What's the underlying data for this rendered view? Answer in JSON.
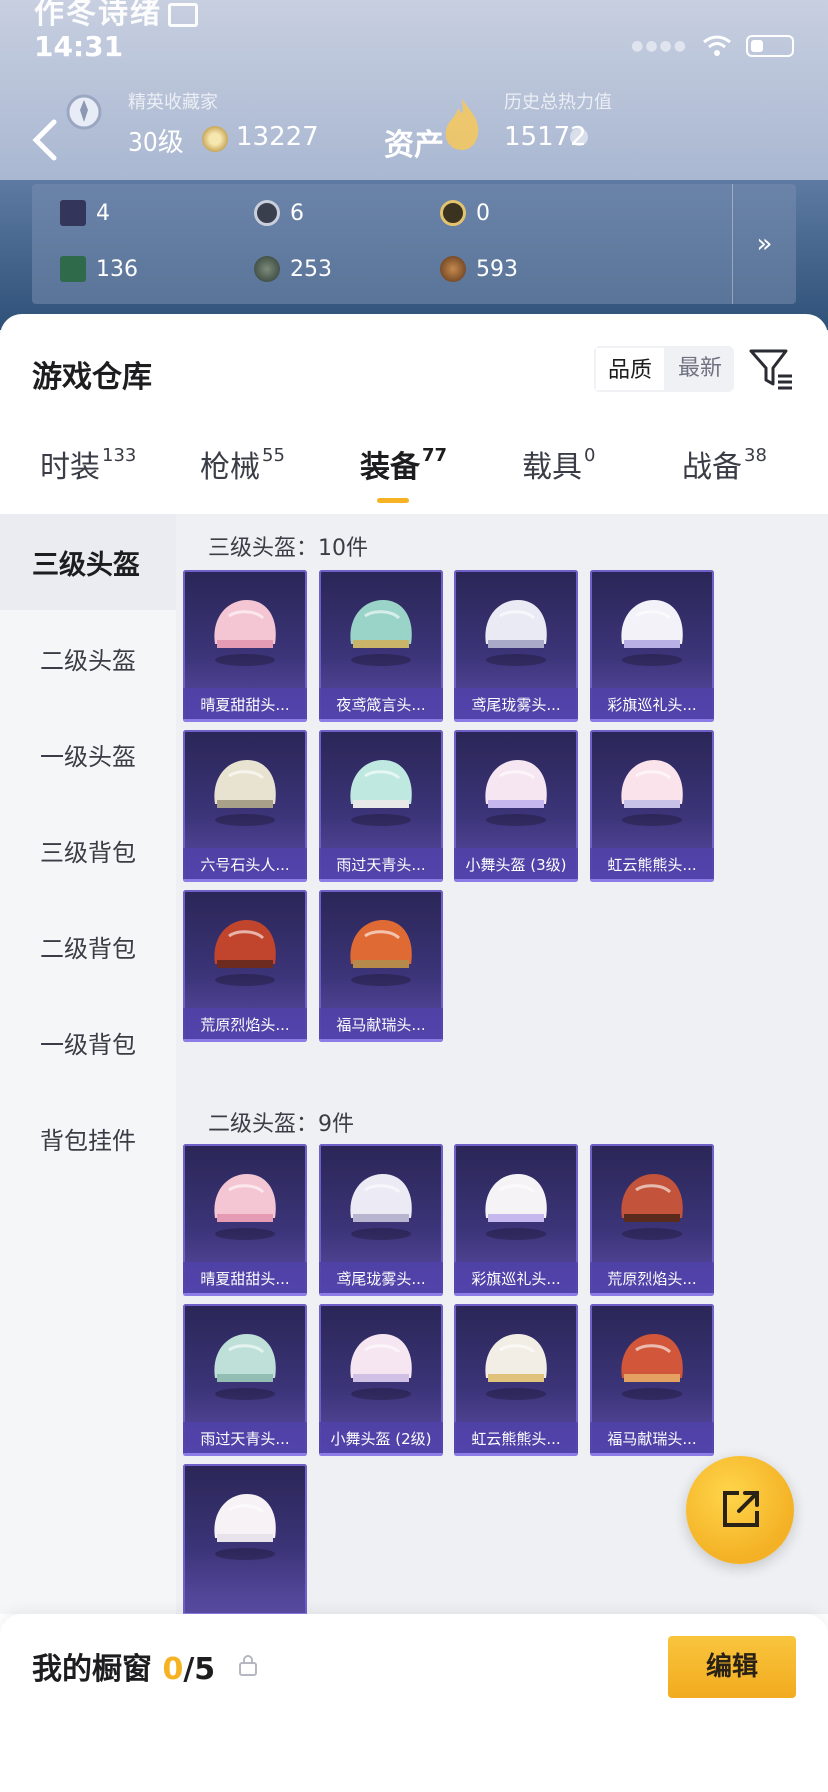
{
  "header": {
    "user_name": "作冬诗绪",
    "time": "14:31",
    "rank_label": "精英收藏家",
    "level": "30级",
    "coins": "13227",
    "asset_label": "资产",
    "heat_label": "历史总热力值",
    "heat_value": "15172",
    "stats": [
      "4",
      "6",
      "0",
      "136",
      "253",
      "593"
    ],
    "more": "»"
  },
  "warehouse": {
    "title": "游戏仓库",
    "sort": [
      "品质",
      "最新"
    ],
    "tabs": [
      {
        "label": "时装",
        "count": "133"
      },
      {
        "label": "枪械",
        "count": "55"
      },
      {
        "label": "装备",
        "count": "77"
      },
      {
        "label": "载具",
        "count": "0"
      },
      {
        "label": "战备",
        "count": "38"
      }
    ],
    "categories": [
      "三级头盔",
      "二级头盔",
      "一级头盔",
      "三级背包",
      "二级背包",
      "一级背包",
      "背包挂件"
    ],
    "sections": [
      {
        "title": "三级头盔：10件",
        "items": [
          "晴夏甜甜头...",
          "夜鸢箴言头...",
          "鸢尾珑雾头...",
          "彩旗巡礼头...",
          "六号石头人...",
          "雨过天青头...",
          "小舞头盔 (3级)",
          "虹云熊熊头...",
          "荒原烈焰头...",
          "福马献瑞头..."
        ]
      },
      {
        "title": "二级头盔：9件",
        "items": [
          "晴夏甜甜头...",
          "鸢尾珑雾头...",
          "彩旗巡礼头...",
          "荒原烈焰头...",
          "雨过天青头...",
          "小舞头盔 (2级)",
          "虹云熊熊头...",
          "福马献瑞头...",
          ""
        ]
      }
    ]
  },
  "showcase": {
    "title": "我的橱窗",
    "count": "0",
    "total": "/5",
    "edit_label": "编辑"
  },
  "colors": {
    "accent": "#f5b324",
    "card": "#3b3478",
    "card_label": "#5042aa"
  }
}
